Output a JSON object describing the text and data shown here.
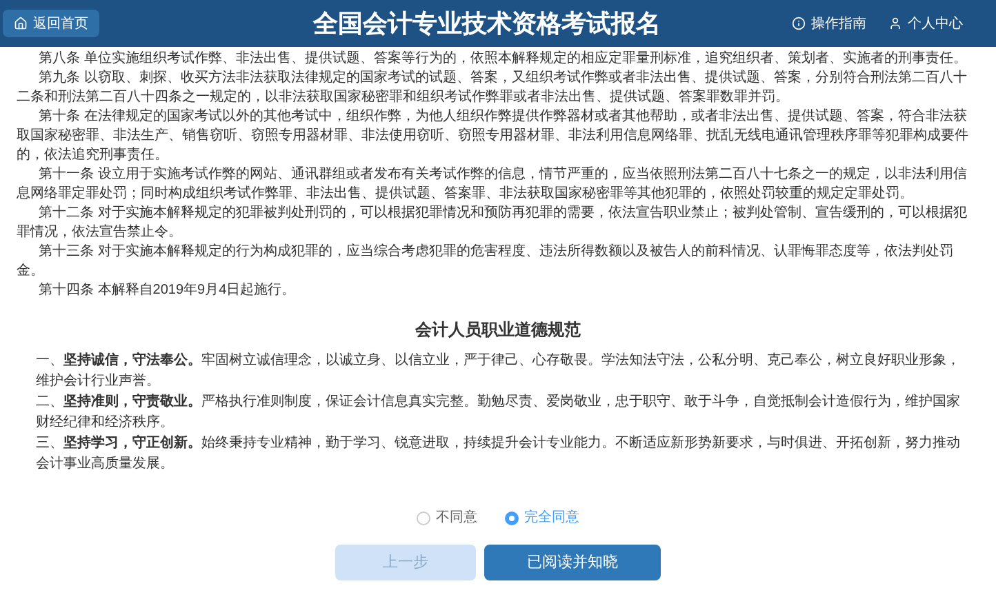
{
  "header": {
    "back_button": "返回首页",
    "title": "全国会计专业技术资格考试报名",
    "links": [
      "操作指南",
      "个人中心"
    ]
  },
  "articles": [
    "第八条 单位实施组织考试作弊、非法出售、提供试题、答案等行为的，依照本解释规定的相应定罪量刑标准，追究组织者、策划者、实施者的刑事责任。",
    "第九条 以窃取、刺探、收买方法非法获取法律规定的国家考试的试题、答案，又组织考试作弊或者非法出售、提供试题、答案，分别符合刑法第二百八十二条和刑法第二百八十四条之一规定的，以非法获取国家秘密罪和组织考试作弊罪或者非法出售、提供试题、答案罪数罪并罚。",
    "第十条 在法律规定的国家考试以外的其他考试中，组织作弊，为他人组织作弊提供作弊器材或者其他帮助，或者非法出售、提供试题、答案，符合非法获取国家秘密罪、非法生产、销售窃听、窃照专用器材罪、非法使用窃听、窃照专用器材罪、非法利用信息网络罪、扰乱无线电通讯管理秩序罪等犯罪构成要件的，依法追究刑事责任。",
    "第十一条 设立用于实施考试作弊的网站、通讯群组或者发布有关考试作弊的信息，情节严重的，应当依照刑法第二百八十七条之一的规定，以非法利用信息网络罪定罪处罚；同时构成组织考试作弊罪、非法出售、提供试题、答案罪、非法获取国家秘密罪等其他犯罪的，依照处罚较重的规定定罪处罚。",
    "第十二条 对于实施本解释规定的犯罪被判处刑罚的，可以根据犯罪情况和预防再犯罪的需要，依法宣告职业禁止；被判处管制、宣告缓刑的，可以根据犯罪情况，依法宣告禁止令。",
    "第十三条 对于实施本解释规定的行为构成犯罪的，应当综合考虑犯罪的危害程度、违法所得数额以及被告人的前科情况、认罪悔罪态度等，依法判处罚金。",
    "第十四条 本解释自2019年9月4日起施行。"
  ],
  "ethics": {
    "title": "会计人员职业道德规范",
    "items": [
      "一、**坚持诚信，守法奉公。**牢固树立诚信理念，以诚立身、以信立业，严于律己、心存敬畏。学法知法守法，公私分明、克己奉公，树立良好职业形象，维护会计行业声誉。",
      "二、**坚持准则，守责敬业。**严格执行准则制度，保证会计信息真实完整。勤勉尽责、爱岗敬业，忠于职守、敢于斗争，自觉抵制会计造假行为，维护国家财经纪律和经济秩序。",
      "三、**坚持学习，守正创新。**始终秉持专业精神，勤于学习、锐意进取，持续提升会计专业能力。不断适应新形势新要求，与时俱进、开拓创新，努力推动会计事业高质量发展。"
    ]
  },
  "agreement": [
    {
      "label": "不同意",
      "selected": false
    },
    {
      "label": "完全同意",
      "selected": true
    }
  ],
  "buttons": [
    {
      "label": "上一步",
      "disabled": true
    },
    {
      "label": "已阅读并知晓",
      "disabled": false
    }
  ]
}
